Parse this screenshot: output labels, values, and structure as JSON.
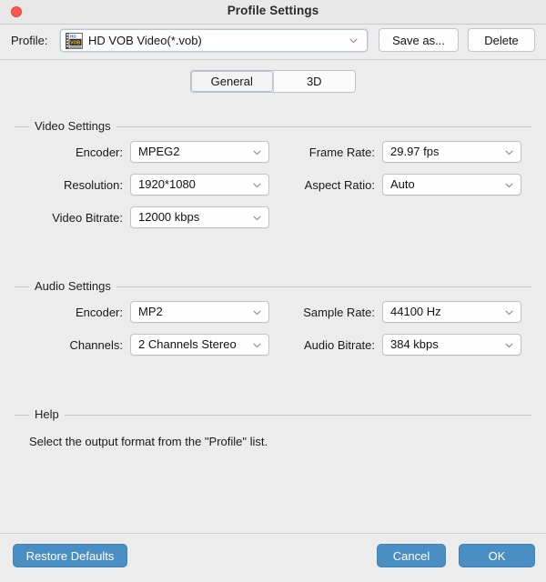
{
  "window": {
    "title": "Profile Settings",
    "close_icon": "close-icon"
  },
  "profile_bar": {
    "label": "Profile:",
    "selected_profile": "HD VOB Video(*.vob)",
    "profile_icon": "vob-file-icon",
    "save_as_label": "Save as...",
    "delete_label": "Delete"
  },
  "tabs": [
    {
      "label": "General",
      "selected": true
    },
    {
      "label": "3D",
      "selected": false
    }
  ],
  "video_settings": {
    "title": "Video Settings",
    "fields": [
      {
        "label": "Encoder:",
        "value": "MPEG2"
      },
      {
        "label": "Resolution:",
        "value": "1920*1080"
      },
      {
        "label": "Video Bitrate:",
        "value": "12000 kbps"
      },
      {
        "label": "Frame Rate:",
        "value": "29.97 fps"
      },
      {
        "label": "Aspect Ratio:",
        "value": "Auto"
      }
    ]
  },
  "audio_settings": {
    "title": "Audio Settings",
    "fields": [
      {
        "label": "Encoder:",
        "value": "MP2"
      },
      {
        "label": "Channels:",
        "value": "2 Channels Stereo"
      },
      {
        "label": "Sample Rate:",
        "value": "44100 Hz"
      },
      {
        "label": "Audio Bitrate:",
        "value": "384 kbps"
      }
    ]
  },
  "help": {
    "title": "Help",
    "text": "Select the output format from the \"Profile\" list."
  },
  "footer": {
    "restore_defaults_label": "Restore Defaults",
    "cancel_label": "Cancel",
    "ok_label": "OK"
  },
  "colors": {
    "window_background": "#ececec",
    "accent_button": "#4a8fc4",
    "close_button": "#f9574f",
    "field_background": "#fefefe",
    "focus_ring": "#b9c6d4"
  }
}
